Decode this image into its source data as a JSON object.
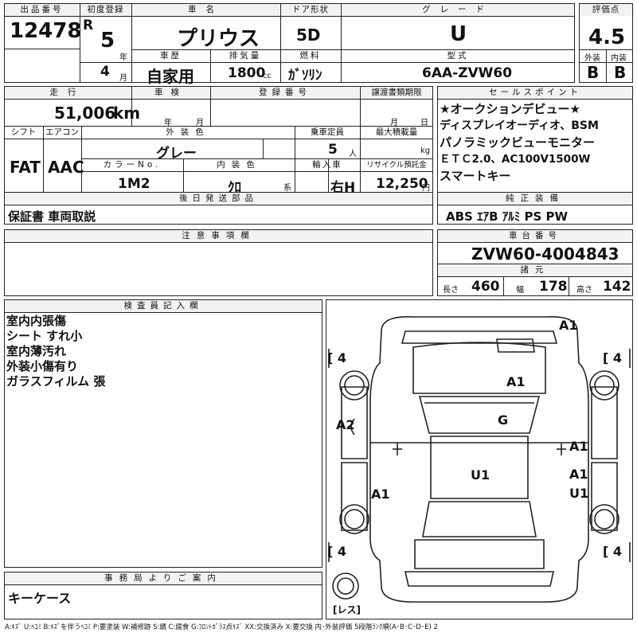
{
  "header": {
    "lot_label": "出品番号",
    "lot_number": "12478",
    "first_reg_label": "初度登録",
    "era": "R",
    "reg_year": "5",
    "year_unit": "年",
    "reg_month": "4",
    "month_unit": "月",
    "name_label": "車名",
    "car_name": "プリウス",
    "door_label": "ドア形状",
    "door": "5D",
    "grade_label": "グレード",
    "grade": "U",
    "score_label": "評価点",
    "score": "4.5",
    "ext_label": "外装",
    "ext_grade": "B",
    "int_label": "内装",
    "int_grade": "B",
    "history_label": "車歴",
    "history": "自家用",
    "displacement_label": "排気量",
    "displacement": "1800",
    "displacement_unit": "cc",
    "fuel_label": "燃料",
    "fuel": "ｶﾞｿﾘﾝ",
    "model_label": "型式",
    "model": "6AA-ZVW60"
  },
  "specs": {
    "mileage_label": "走行",
    "mileage": "51,006",
    "mileage_unit": "km",
    "inspection_label": "車検",
    "insp_year_unit": "年",
    "insp_month_unit": "月",
    "reg_no_label": "登録番号",
    "transfer_label": "譲渡書類期限",
    "transfer_month_unit": "月",
    "transfer_day_unit": "日",
    "shift_label": "シフト",
    "shift": "FAT",
    "ac_label": "エアコン",
    "ac": "AAC",
    "color_label": "外装色",
    "color": "グレー",
    "capacity_label": "乗車定員",
    "capacity": "5",
    "capacity_unit": "人",
    "load_label": "最大積載量",
    "load_unit": "kg",
    "color_no_label": "カラーNo.",
    "color_no": "1M2",
    "interior_color_label": "内装色",
    "interior_color": "ｸﾛ",
    "interior_unit": "系",
    "import_label": "輸入車",
    "steering": "右H",
    "recycle_label": "リサイクル預託金",
    "recycle": "12,250",
    "recycle_unit": "円",
    "later_label": "後日発送部品",
    "later_items": "保証書 車両取説"
  },
  "selling_points": {
    "label": "セールスポイント",
    "items": [
      "★オークションデビュー★",
      "ディスプレイオーディオ、BSM",
      "パノラミックビューモニター",
      "ＥＴＣ2.0、AC100V1500W",
      "スマートキー"
    ]
  },
  "equipment": {
    "label": "純正装備",
    "items": "ABS ｴｱB ｱﾙﾐ PS PW"
  },
  "notes": {
    "label": "注意事項欄"
  },
  "chassis": {
    "label": "車台番号",
    "number": "ZVW60-4004843",
    "dims_label": "諸元",
    "length_label": "長さ",
    "length": "460",
    "width_label": "幅",
    "width": "178",
    "height_label": "高さ",
    "height": "142"
  },
  "inspector": {
    "label": "検査員記入欄",
    "items": [
      "室内内張傷",
      "シート すれ小",
      "室内薄汚れ",
      "外装小傷有り",
      "ガラスフィルム 張"
    ]
  },
  "diagram": {
    "marks": {
      "a1_top": "A1",
      "a1_hood": "A1",
      "g_windshield": "G",
      "a2_left": "A2",
      "a1_right_front": "A1",
      "a1_right_rear": "A1",
      "u1_right": "U1",
      "u1_roof": "U1",
      "a1_left_rear": "A1"
    },
    "tire_fl": "4",
    "tire_fr": "4",
    "tire_rl": "4",
    "tire_rr": "4",
    "spare_label": "レス"
  },
  "office": {
    "label": "事務局よりご案内",
    "text": "キーケース"
  },
  "legend": "A:ｷｽﾞ  U:ﾍｺﾐ  B:ｷｽﾞを伴うﾍｺﾐ  P:要塗装  W:補修跡  S:錆  C:腐食  G:ﾌﾛﾝﾄｶﾞﾗｽ点ｷｽﾞ  XX:交換済み  X:要交換  内･外装評価  5段階ﾗﾝｸ順(A･B･C･D･E)  2"
}
